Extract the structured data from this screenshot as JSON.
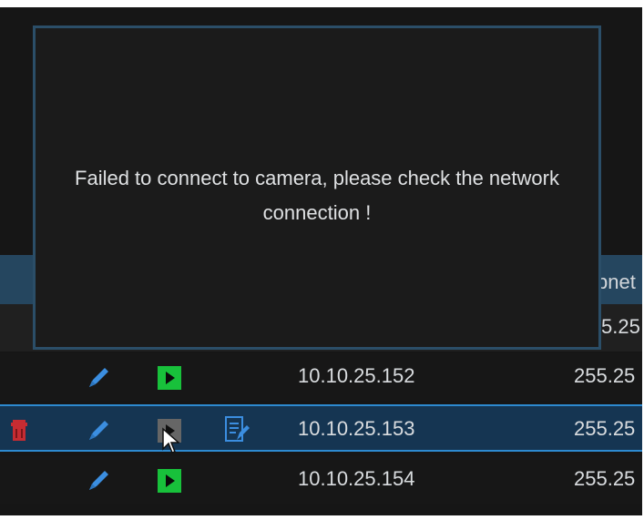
{
  "dialog": {
    "message": "Failed to connect to camera, please check the network connection !"
  },
  "table": {
    "header_partial": "bnet",
    "partial_row": {
      "subnet": "5.25"
    },
    "rows": [
      {
        "ip": "10.10.25.152",
        "subnet": "255.25",
        "play_state": "available",
        "selected": false
      },
      {
        "ip": "10.10.25.153",
        "subnet": "255.25",
        "play_state": "disabled",
        "selected": true
      },
      {
        "ip": "10.10.25.154",
        "subnet": "255.25",
        "play_state": "available",
        "selected": false
      }
    ]
  },
  "icons": {
    "edit": "pencil-icon",
    "play": "play-icon",
    "delete": "trash-icon",
    "settings": "document-edit-icon",
    "cursor": "mouse-pointer-icon"
  },
  "colors": {
    "accent": "#2d8ad0",
    "header": "#25465f",
    "selected": "#153552",
    "play_active": "#18c13b",
    "delete": "#c62c32"
  }
}
